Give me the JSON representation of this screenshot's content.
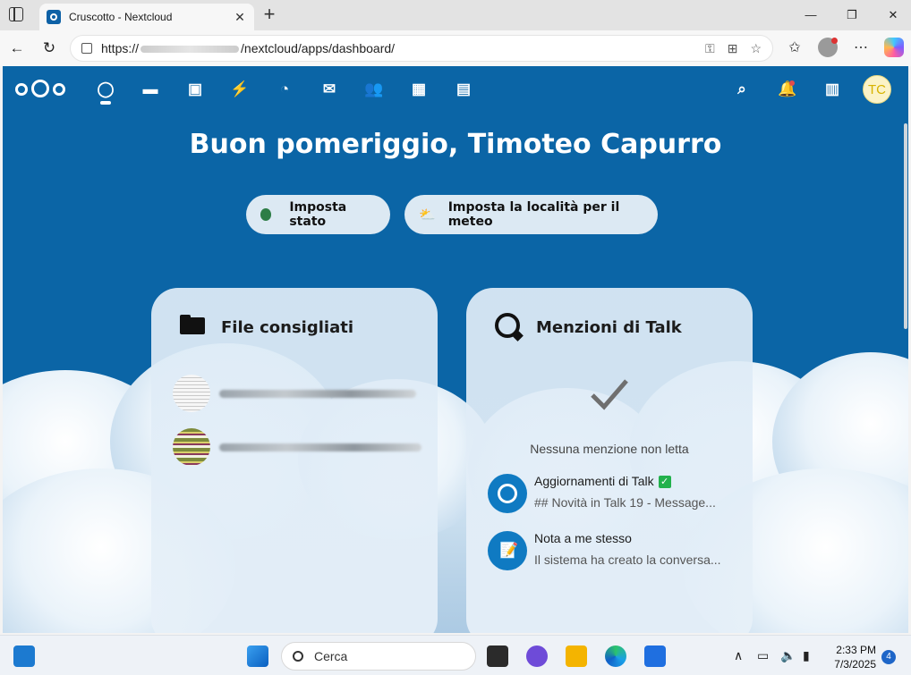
{
  "browser": {
    "tab_title": "Cruscotto - Nextcloud",
    "url_prefix": "https://",
    "url_path": "/nextcloud/apps/dashboard/"
  },
  "header": {
    "avatar_initials": "TC",
    "apps": [
      "dashboard-icon",
      "files-icon",
      "photos-icon",
      "activity-icon",
      "talk-icon",
      "mail-icon",
      "contacts-icon",
      "calendar-icon",
      "deck-icon"
    ]
  },
  "greeting": "Buon pomeriggio, Timoteo Capurro",
  "actions": {
    "set_status": "Imposta stato",
    "set_weather": "Imposta la località per il meteo"
  },
  "widgets": {
    "files": {
      "title": "File consigliati"
    },
    "talk": {
      "title": "Menzioni di Talk",
      "empty": "Nessuna menzione non letta",
      "items": [
        {
          "title": "Aggiornamenti di Talk",
          "subtitle": "## Novità in Talk 19 - Message..."
        },
        {
          "title": "Nota a me stesso",
          "subtitle": "Il sistema ha creato la conversa..."
        }
      ]
    }
  },
  "taskbar": {
    "search_placeholder": "Cerca",
    "time": "2:33 PM",
    "date": "7/3/2025",
    "notification_count": "4"
  },
  "colors": {
    "nextcloud_blue": "#0b65a6",
    "status_green": "#2d7d46"
  }
}
